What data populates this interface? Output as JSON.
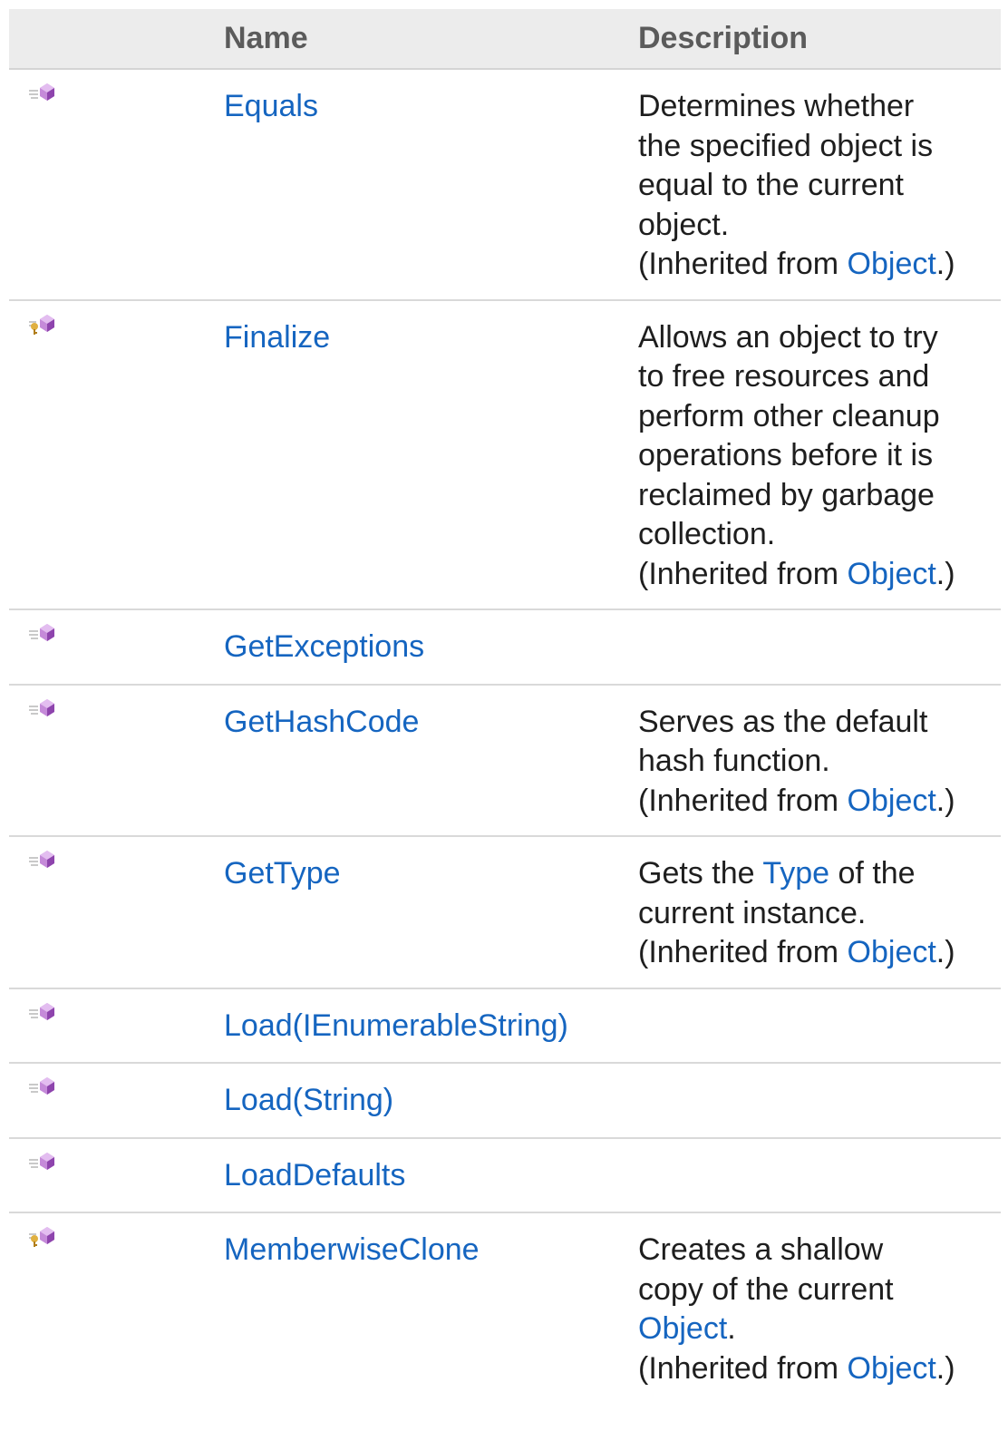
{
  "table": {
    "headers": {
      "icon": "",
      "name": "Name",
      "description": "Description"
    },
    "inherited_prefix": "(Inherited from ",
    "inherited_suffix": ".)",
    "rows": [
      {
        "icon": "public-method-icon",
        "name": "Equals",
        "description_lines": [
          "Determines whether",
          "the specified object is",
          "equal to the current",
          "object."
        ],
        "inherited_from": "Object"
      },
      {
        "icon": "protected-method-icon",
        "name": "Finalize",
        "description_lines": [
          "Allows an object to try",
          "to free resources and",
          "perform other cleanup",
          "operations before it is",
          "reclaimed by garbage",
          "collection."
        ],
        "inherited_from": "Object"
      },
      {
        "icon": "public-method-icon",
        "name": "GetExceptions",
        "description_lines": [],
        "inherited_from": null
      },
      {
        "icon": "public-method-icon",
        "name": "GetHashCode",
        "description_lines": [
          "Serves as the default",
          "hash function."
        ],
        "inherited_from": "Object"
      },
      {
        "icon": "public-method-icon",
        "name": "GetType",
        "description_parts": {
          "before": "Gets the ",
          "link": "Type",
          "after": " of the"
        },
        "description_lines": [
          "current instance."
        ],
        "inherited_from": "Object"
      },
      {
        "icon": "public-method-icon",
        "name": "Load(IEnumerableString)",
        "description_lines": [],
        "inherited_from": null
      },
      {
        "icon": "public-method-icon",
        "name": "Load(String)",
        "description_lines": [],
        "inherited_from": null
      },
      {
        "icon": "public-method-icon",
        "name": "LoadDefaults",
        "description_lines": [],
        "inherited_from": null
      },
      {
        "icon": "protected-method-icon",
        "name": "MemberwiseClone",
        "description_lines": [
          "Creates a shallow",
          "copy of the current"
        ],
        "description_trailing_link": {
          "link": "Object",
          "after": "."
        },
        "inherited_from": "Object"
      }
    ]
  }
}
